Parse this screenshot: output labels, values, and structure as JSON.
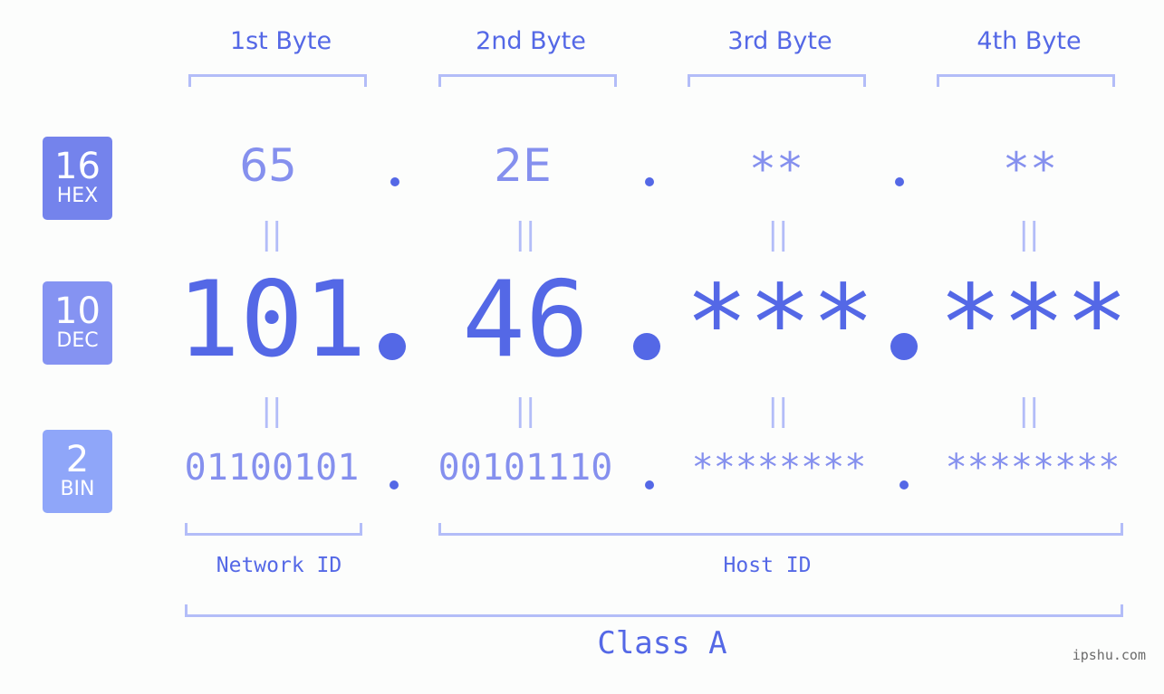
{
  "bytes": [
    {
      "title": "1st Byte",
      "hex": "65",
      "dec": "101",
      "bin": "01100101"
    },
    {
      "title": "2nd Byte",
      "hex": "2E",
      "dec": "46",
      "bin": "00101110"
    },
    {
      "title": "3rd Byte",
      "hex": "**",
      "dec": "***",
      "bin": "********"
    },
    {
      "title": "4th Byte",
      "hex": "**",
      "dec": "***",
      "bin": "********"
    }
  ],
  "badges": {
    "hex": {
      "base": "16",
      "label": "HEX",
      "color": "#7483ec"
    },
    "dec": {
      "base": "10",
      "label": "DEC",
      "color": "#8593f2"
    },
    "bin": {
      "base": "2",
      "label": "BIN",
      "color": "#8fa6f9"
    }
  },
  "equals_symbol": "||",
  "segments": {
    "network_id": "Network ID",
    "host_id": "Host ID"
  },
  "ip_class": "Class A",
  "watermark": "ipshu.com",
  "colors": {
    "primary": "#5468e6",
    "secondary": "#8590ee",
    "bracket": "#b3bdf8",
    "background": "#fcfdfc"
  }
}
